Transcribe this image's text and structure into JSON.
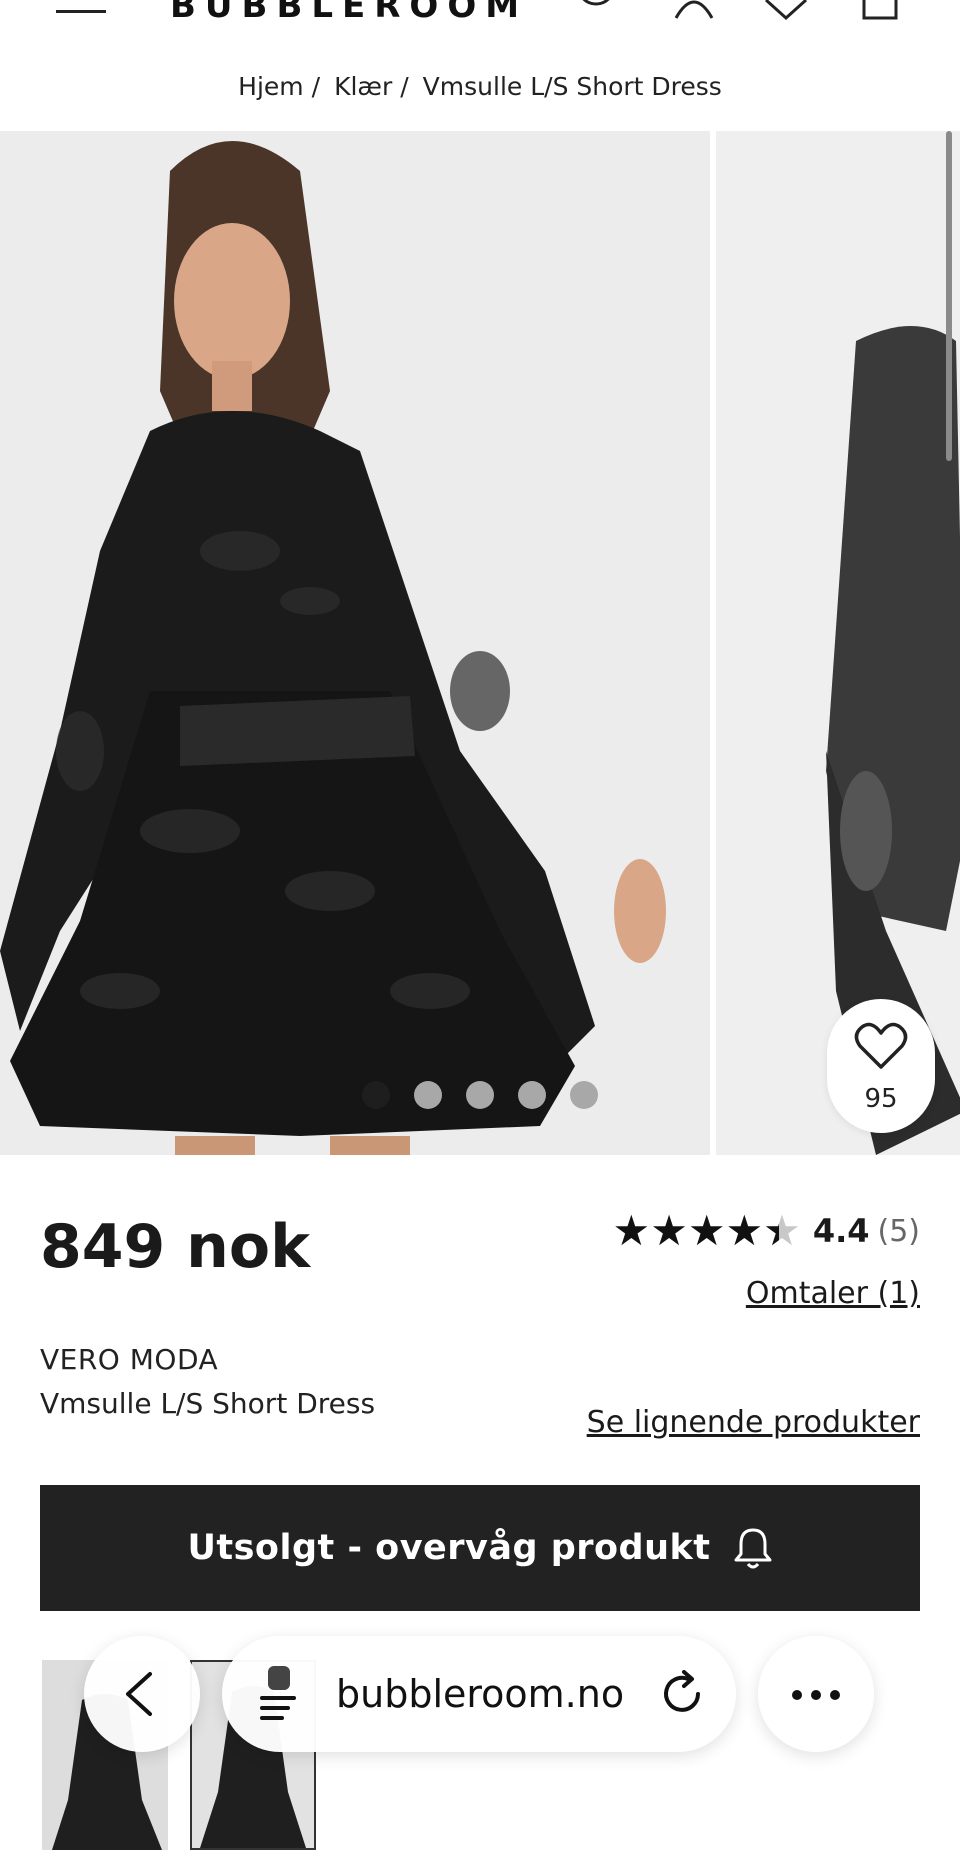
{
  "header": {
    "logo": "BUBBLEROOM",
    "icons": [
      "menu-icon",
      "search-icon",
      "account-icon",
      "wishlist-icon",
      "cart-icon"
    ]
  },
  "breadcrumb": {
    "items": [
      "Hjem",
      "Klær",
      "Vmsulle L/S Short Dress"
    ],
    "separator": "/"
  },
  "gallery": {
    "image_count": 5,
    "active_index": 0,
    "favorites_count": "95",
    "icons": [
      "heart-icon",
      "play-icon"
    ]
  },
  "product": {
    "price": "849 nok",
    "rating": {
      "value": "4.4",
      "count": "(5)",
      "stars": 4.4,
      "max_stars": 5
    },
    "reviews_link": "Omtaler (1)",
    "brand": "VERO MODA",
    "name": "Vmsulle L/S Short Dress",
    "similar_link": "Se lignende produkter",
    "cta_label": "Utsolgt - overvåg produkt",
    "cta_icon": "bell-icon"
  },
  "browser": {
    "url": "bubbleroom.no",
    "icons": [
      "back-icon",
      "site-settings-icon",
      "reload-icon",
      "more-icon"
    ]
  },
  "colors": {
    "cta_background": "#222222",
    "active_dot": "#1e1e1e",
    "inactive_dot": "#a8a8a8",
    "photo_background": "#ececec"
  }
}
